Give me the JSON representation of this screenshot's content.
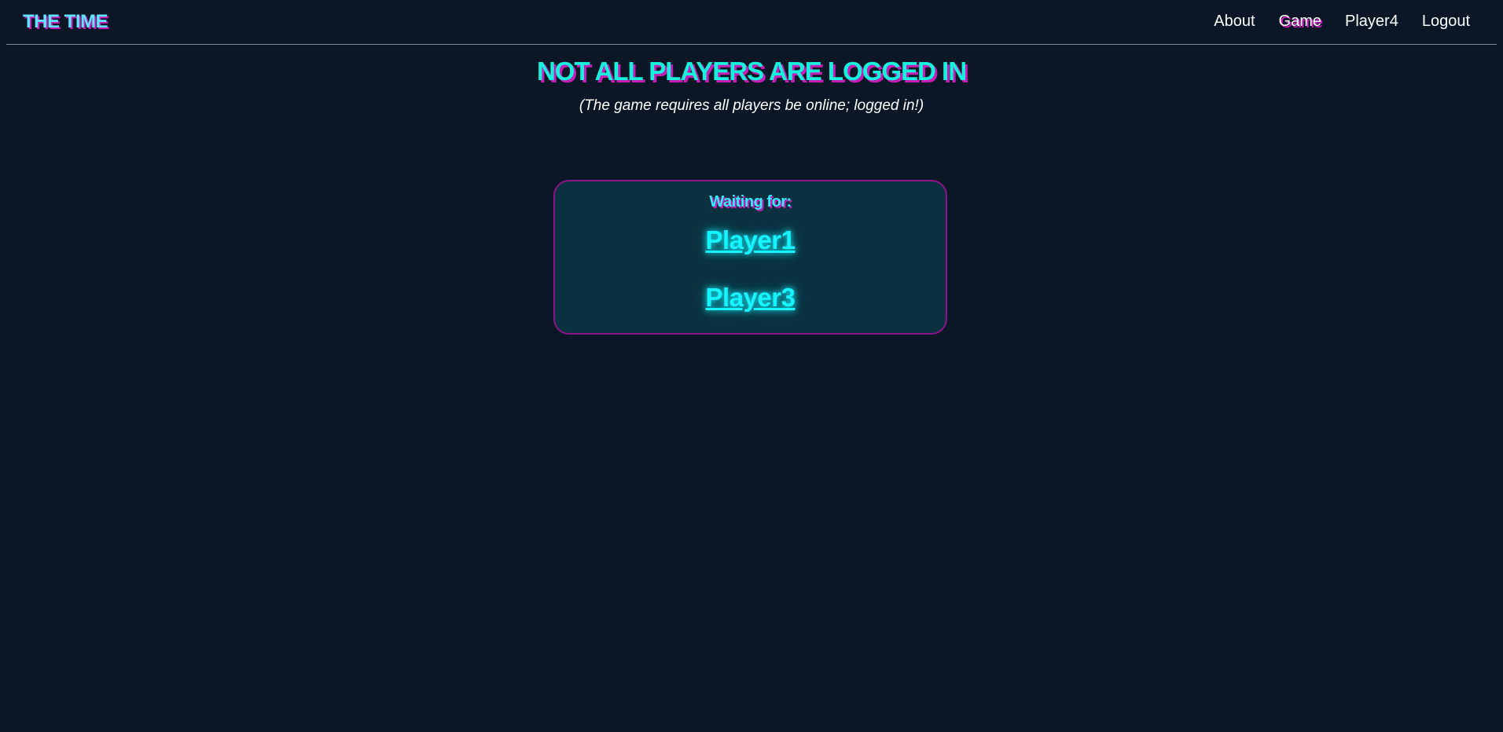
{
  "navbar": {
    "brand": "THE TIME",
    "links": [
      {
        "label": "About"
      },
      {
        "label": "Game",
        "active": true
      },
      {
        "label": "Player4"
      },
      {
        "label": "Logout"
      }
    ]
  },
  "main": {
    "title": "NOT ALL PLAYERS ARE LOGGED IN",
    "subtitle": "(The game requires all players be online; logged in!)",
    "waiting": {
      "label": "Waiting for:",
      "players": [
        "Player1",
        "Player3"
      ]
    }
  },
  "colors": {
    "background": "#0b1727",
    "accent_cyan": "#18f0de",
    "accent_magenta": "#c51cb6",
    "box_background": "#0b3140",
    "box_border": "#8e1388"
  }
}
